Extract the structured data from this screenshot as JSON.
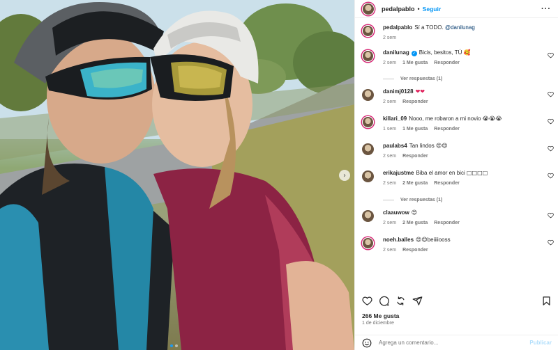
{
  "post": {
    "author": "pedalpablo",
    "separator": "•",
    "follow_label": "Seguir",
    "more_label": "···",
    "caption": {
      "user": "pedalpablo",
      "text": "Sí a TODO. ",
      "mention": "@danilunag",
      "time": "2 sem"
    },
    "carousel_next": "›",
    "likes": "266 Me gusta",
    "date": "1 de diciembre",
    "add_comment_placeholder": "Agrega un comentario...",
    "publish_label": "Publicar"
  },
  "comments": [
    {
      "user": "danilunag",
      "verified": true,
      "text": "Bicis, besitos, TÚ",
      "emoji": "🥰",
      "time": "2 sem",
      "likes": "1 Me gusta",
      "reply": "Responder",
      "view_replies": "Ver respuestas (1)"
    },
    {
      "user": "danimj0128",
      "text": "",
      "emoji": "❤❤",
      "time": "2 sem",
      "likes": "",
      "reply": "Responder"
    },
    {
      "user": "killari_09",
      "text": "Nooo, me robaron a mi novio",
      "emoji": "😭😭😭",
      "time": "1 sem",
      "likes": "1 Me gusta",
      "reply": "Responder"
    },
    {
      "user": "paulabs4",
      "text": "Tan lindos",
      "emoji": "😍😍",
      "time": "2 sem",
      "likes": "",
      "reply": "Responder"
    },
    {
      "user": "erikajustme",
      "text": "Biba el amor en bici",
      "emoji": "□□□□",
      "time": "2 sem",
      "likes": "2 Me gusta",
      "reply": "Responder",
      "view_replies": "Ver respuestas (1)"
    },
    {
      "user": "claauwow",
      "text": "",
      "emoji": "😍",
      "time": "2 sem",
      "likes": "2 Me gusta",
      "reply": "Responder"
    },
    {
      "user": "noeh.balles",
      "text": "beiiiiooss",
      "emoji": "😍😍",
      "time": "2 sem",
      "likes": "",
      "reply": "Responder"
    }
  ],
  "icons": {
    "like": "heart-icon",
    "comment": "comment-icon",
    "share": "share-icon",
    "repost": "repost-icon",
    "save": "bookmark-icon",
    "emoji": "smiley-icon"
  },
  "colors": {
    "accent": "#0095f6",
    "publish_disabled": "#b2dffc",
    "muted": "#737373",
    "heart_red": "#e0245e"
  }
}
